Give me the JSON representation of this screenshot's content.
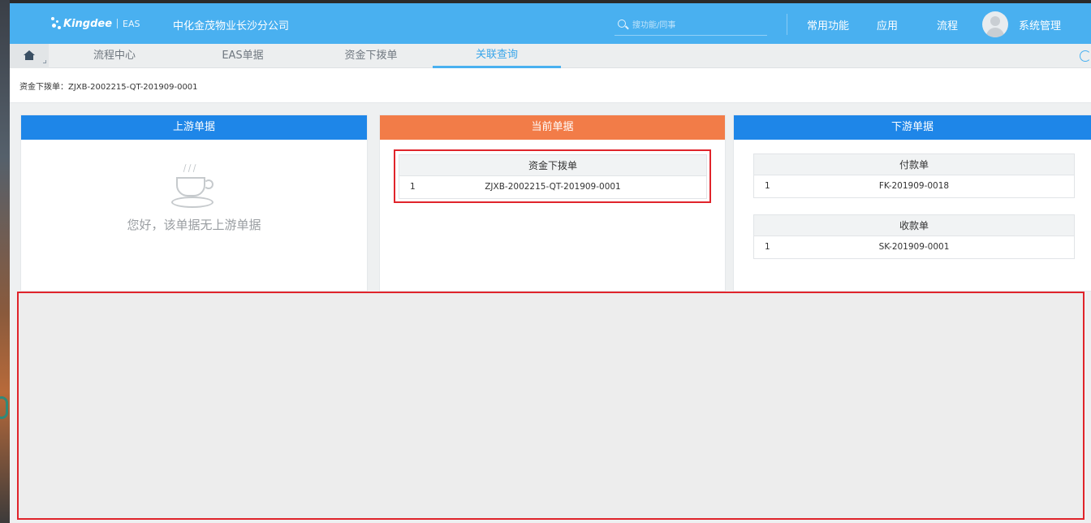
{
  "header": {
    "logo_text": "Kingdee",
    "logo_sub": "EAS",
    "company": "中化金茂物业长沙分公司",
    "search_placeholder": "搜功能/同事",
    "links": [
      "常用功能",
      "应用",
      "流程"
    ],
    "user_name": "系统管理",
    "bg_color": "#49b0f0"
  },
  "tabs": [
    {
      "label": "流程中心",
      "active": false
    },
    {
      "label": "EAS单据",
      "active": false
    },
    {
      "label": "资金下拨单",
      "active": false
    },
    {
      "label": "关联查询",
      "active": true
    }
  ],
  "breadcrumb": "资金下拨单：ZJXB-2002215-QT-201909-0001",
  "panels": {
    "upstream": {
      "title": "上游单据",
      "color": "#1e86e8",
      "empty_text": "您好，该单据无上游单据"
    },
    "current": {
      "title": "当前单据",
      "color": "#f27c48",
      "table": {
        "header": "资金下拨单",
        "rows": [
          {
            "index": "1",
            "number": "ZJXB-2002215-QT-201909-0001"
          }
        ]
      }
    },
    "downstream": {
      "title": "下游单据",
      "color": "#1e86e8",
      "tables": [
        {
          "header": "付款单",
          "rows": [
            {
              "index": "1",
              "number": "FK-201909-0018"
            }
          ]
        },
        {
          "header": "收款单",
          "rows": [
            {
              "index": "1",
              "number": "SK-201909-0001"
            }
          ]
        }
      ]
    }
  }
}
